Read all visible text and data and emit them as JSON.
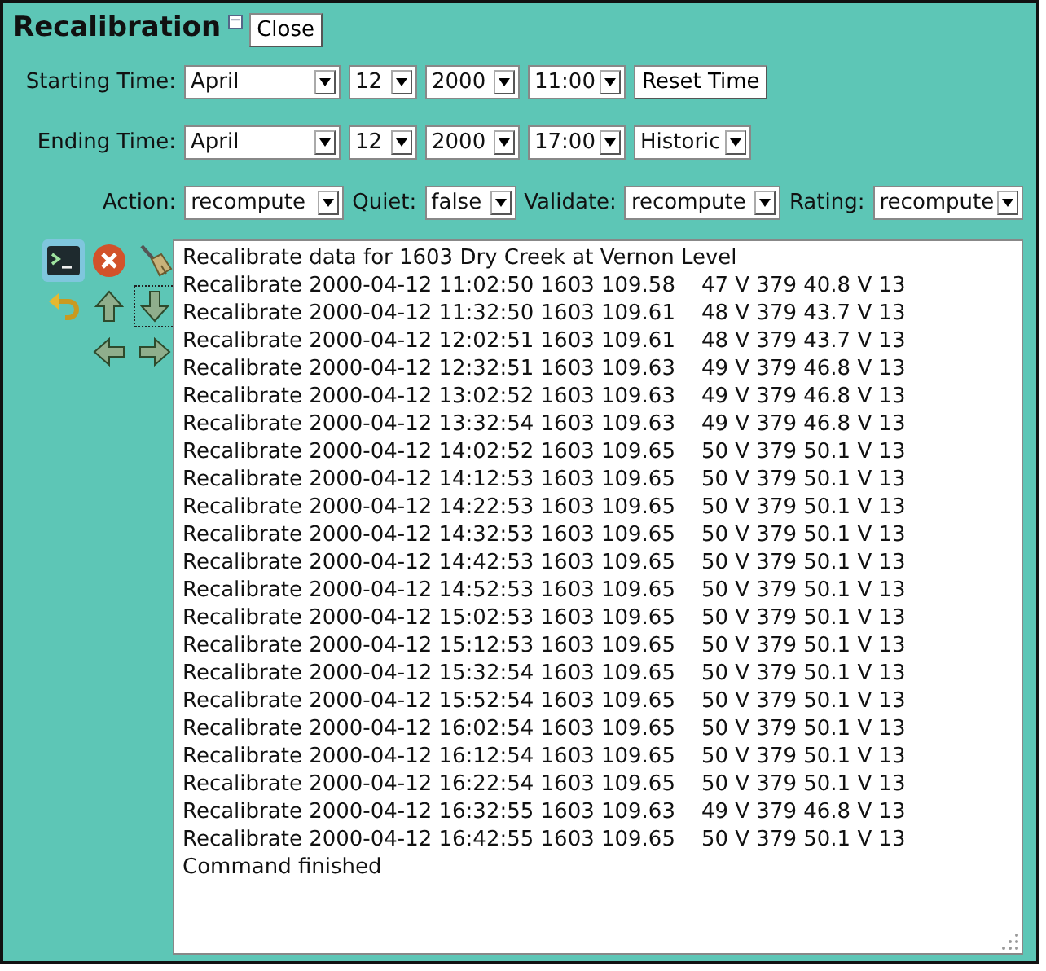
{
  "window": {
    "title": "Recalibration",
    "collapse_icon": "−",
    "close_button": "Close"
  },
  "starting_time": {
    "label": "Starting Time:",
    "month": "April",
    "day": "12",
    "year": "2000",
    "time": "11:00",
    "button": "Reset Time"
  },
  "ending_time": {
    "label": "Ending Time:",
    "month": "April",
    "day": "12",
    "year": "2000",
    "time": "17:00",
    "mode": "Historic"
  },
  "options": [
    {
      "label": "Action:",
      "value": "recompute"
    },
    {
      "label": "Quiet:",
      "value": "false"
    },
    {
      "label": "Validate:",
      "value": "recompute"
    },
    {
      "label": "Rating:",
      "value": "recompute"
    }
  ],
  "tools": [
    {
      "kind": "terminal",
      "selected": true,
      "focused": false
    },
    {
      "kind": "cancel",
      "selected": false,
      "focused": false
    },
    {
      "kind": "broom",
      "selected": false,
      "focused": false
    },
    {
      "kind": "undo",
      "selected": false,
      "focused": false
    },
    {
      "kind": "up",
      "selected": false,
      "focused": false
    },
    {
      "kind": "down",
      "selected": false,
      "focused": true
    },
    {
      "kind": "left",
      "selected": false,
      "focused": false
    },
    {
      "kind": "right",
      "selected": false,
      "focused": false
    }
  ],
  "log": {
    "header": "Recalibrate data for 1603 Dry Creek at Vernon Level",
    "lines": [
      {
        "record": "Recalibrate 2000-04-12 11:02:50 1603 109.58",
        "values": "47 V 379 40.8 V 13"
      },
      {
        "record": "Recalibrate 2000-04-12 11:32:50 1603 109.61",
        "values": "48 V 379 43.7 V 13"
      },
      {
        "record": "Recalibrate 2000-04-12 12:02:51 1603 109.61",
        "values": "48 V 379 43.7 V 13"
      },
      {
        "record": "Recalibrate 2000-04-12 12:32:51 1603 109.63",
        "values": "49 V 379 46.8 V 13"
      },
      {
        "record": "Recalibrate 2000-04-12 13:02:52 1603 109.63",
        "values": "49 V 379 46.8 V 13"
      },
      {
        "record": "Recalibrate 2000-04-12 13:32:54 1603 109.63",
        "values": "49 V 379 46.8 V 13"
      },
      {
        "record": "Recalibrate 2000-04-12 14:02:52 1603 109.65",
        "values": "50 V 379 50.1 V 13"
      },
      {
        "record": "Recalibrate 2000-04-12 14:12:53 1603 109.65",
        "values": "50 V 379 50.1 V 13"
      },
      {
        "record": "Recalibrate 2000-04-12 14:22:53 1603 109.65",
        "values": "50 V 379 50.1 V 13"
      },
      {
        "record": "Recalibrate 2000-04-12 14:32:53 1603 109.65",
        "values": "50 V 379 50.1 V 13"
      },
      {
        "record": "Recalibrate 2000-04-12 14:42:53 1603 109.65",
        "values": "50 V 379 50.1 V 13"
      },
      {
        "record": "Recalibrate 2000-04-12 14:52:53 1603 109.65",
        "values": "50 V 379 50.1 V 13"
      },
      {
        "record": "Recalibrate 2000-04-12 15:02:53 1603 109.65",
        "values": "50 V 379 50.1 V 13"
      },
      {
        "record": "Recalibrate 2000-04-12 15:12:53 1603 109.65",
        "values": "50 V 379 50.1 V 13"
      },
      {
        "record": "Recalibrate 2000-04-12 15:32:54 1603 109.65",
        "values": "50 V 379 50.1 V 13"
      },
      {
        "record": "Recalibrate 2000-04-12 15:52:54 1603 109.65",
        "values": "50 V 379 50.1 V 13"
      },
      {
        "record": "Recalibrate 2000-04-12 16:02:54 1603 109.65",
        "values": "50 V 379 50.1 V 13"
      },
      {
        "record": "Recalibrate 2000-04-12 16:12:54 1603 109.65",
        "values": "50 V 379 50.1 V 13"
      },
      {
        "record": "Recalibrate 2000-04-12 16:22:54 1603 109.65",
        "values": "50 V 379 50.1 V 13"
      },
      {
        "record": "Recalibrate 2000-04-12 16:32:55 1603 109.63",
        "values": "49 V 379 46.8 V 13"
      },
      {
        "record": "Recalibrate 2000-04-12 16:42:55 1603 109.65",
        "values": "50 V 379 50.1 V 13"
      }
    ],
    "footer": "Command finished"
  }
}
